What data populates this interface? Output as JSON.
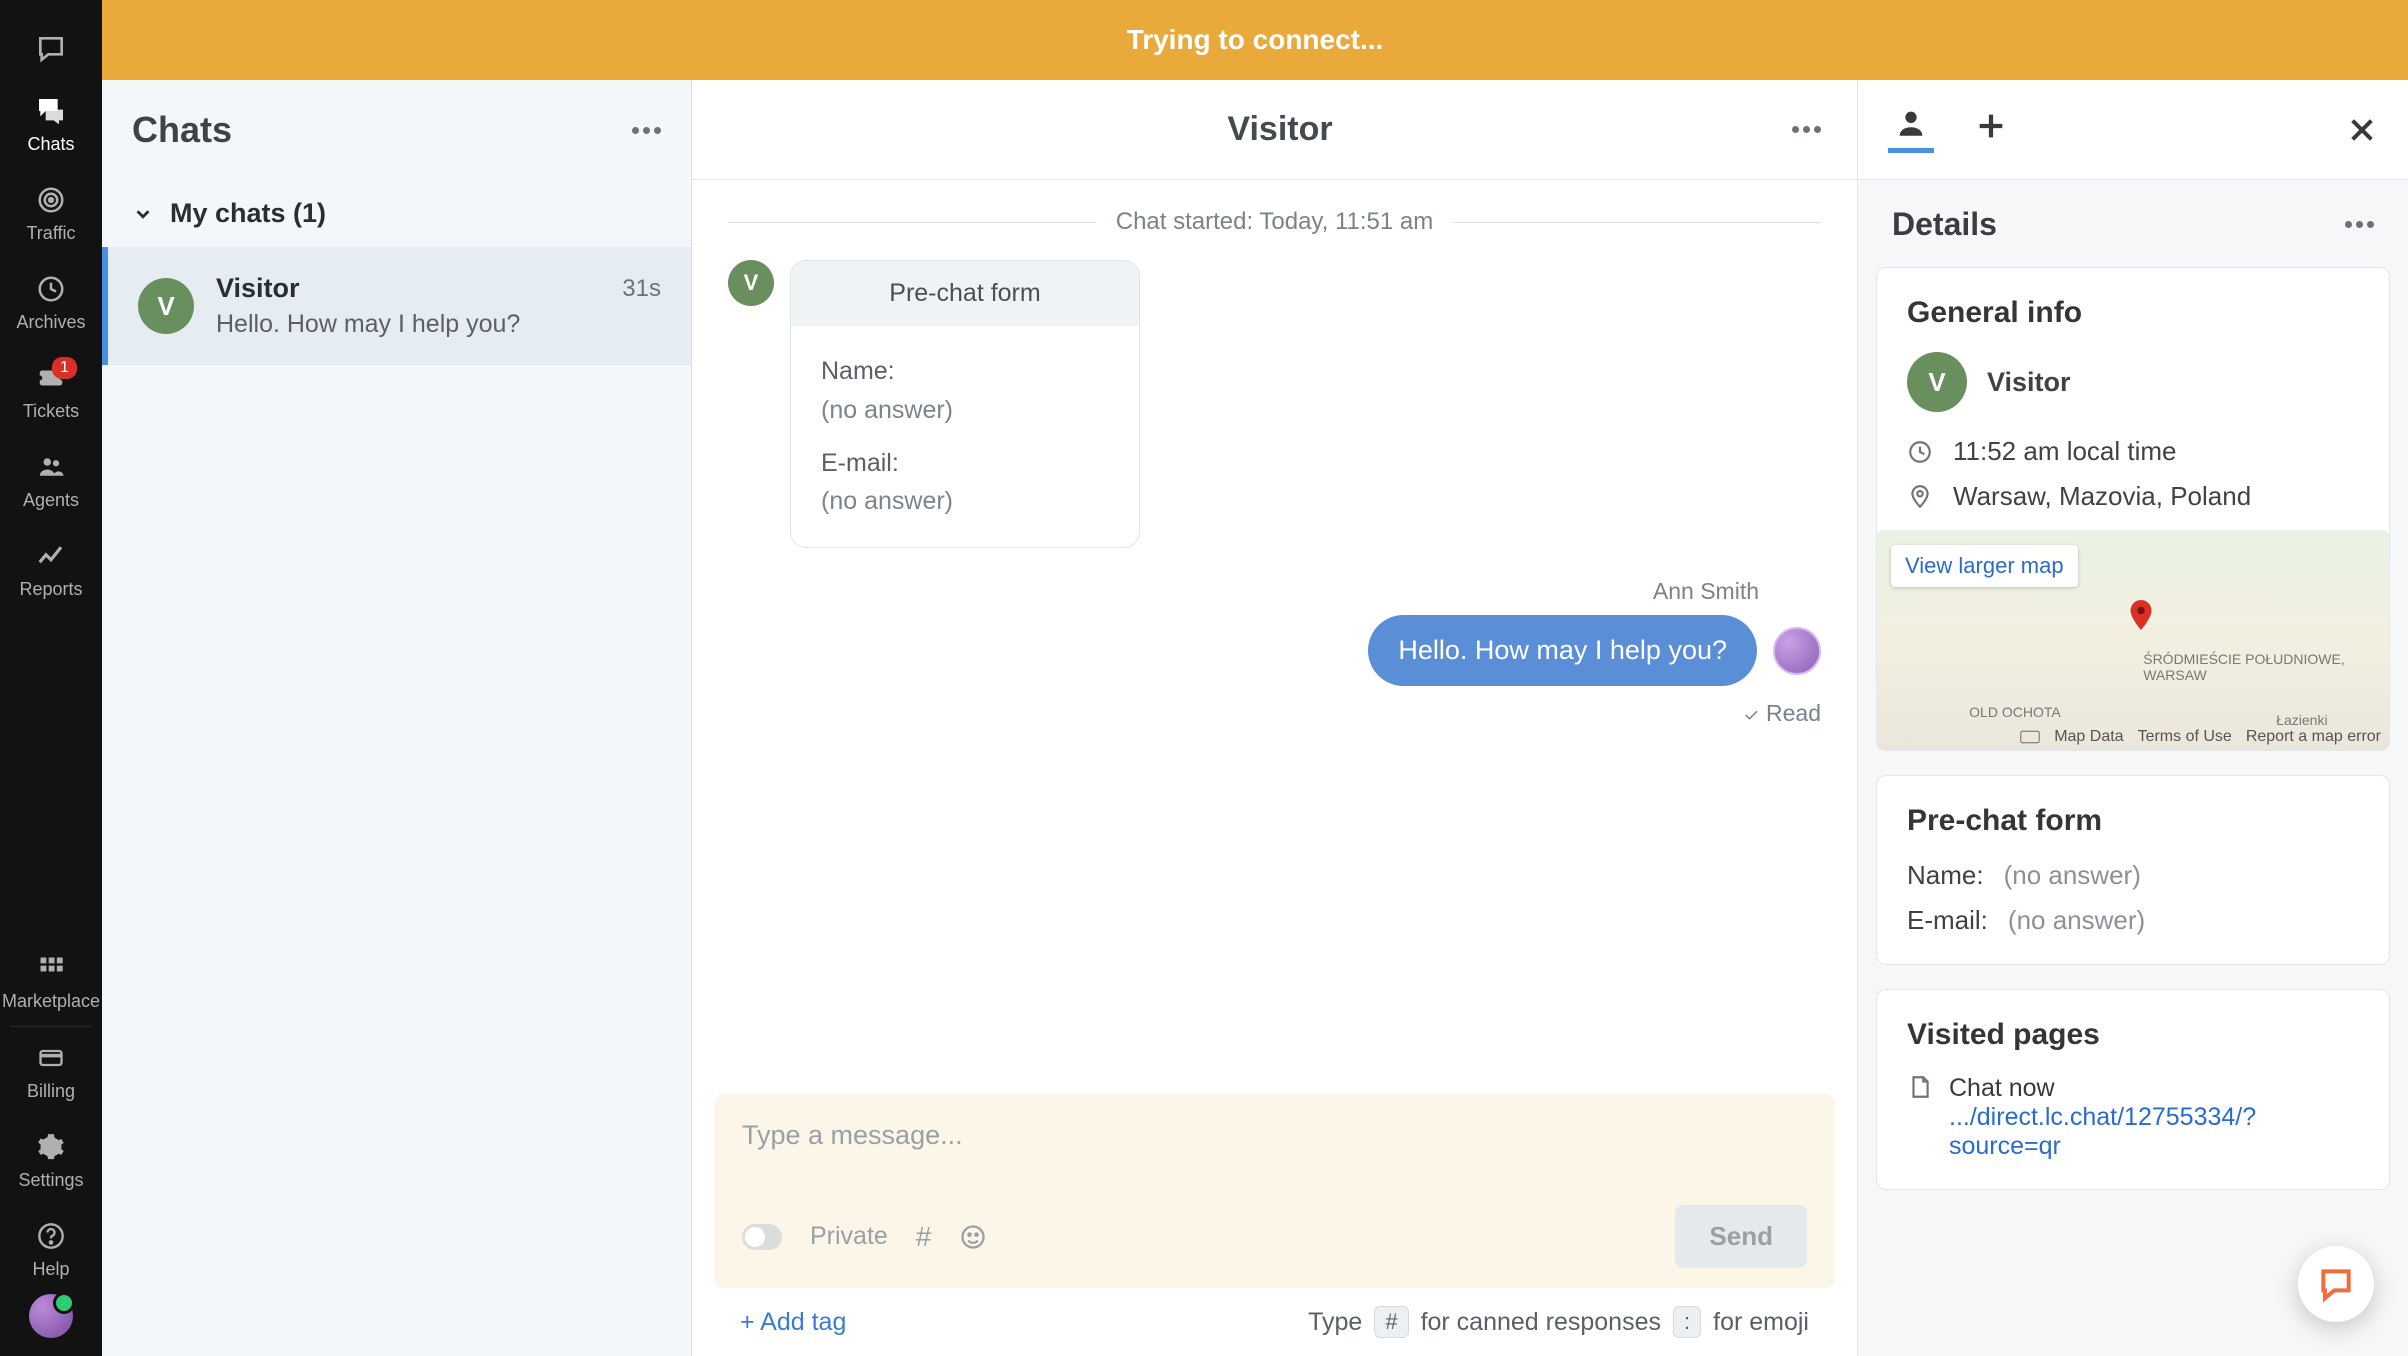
{
  "banner": {
    "text": "Trying to connect..."
  },
  "leftnav": {
    "items": [
      {
        "label": "",
        "icon": "speech-bubble-outline"
      },
      {
        "label": "Chats",
        "icon": "chats",
        "active": true
      },
      {
        "label": "Traffic",
        "icon": "target"
      },
      {
        "label": "Archives",
        "icon": "clock"
      },
      {
        "label": "Tickets",
        "icon": "ticket",
        "badge": "1"
      },
      {
        "label": "Agents",
        "icon": "people"
      },
      {
        "label": "Reports",
        "icon": "trend"
      }
    ],
    "bottom": [
      {
        "label": "Marketplace",
        "icon": "grid"
      },
      {
        "label": "Billing",
        "icon": "card"
      },
      {
        "label": "Settings",
        "icon": "gear"
      },
      {
        "label": "Help",
        "icon": "question"
      }
    ]
  },
  "chatlist": {
    "title": "Chats",
    "section": "My chats (1)",
    "items": [
      {
        "avatar": "V",
        "name": "Visitor",
        "time": "31s",
        "preview": "Hello. How may I help you?"
      }
    ]
  },
  "conversation": {
    "title": "Visitor",
    "started": "Chat started: Today, 11:51 am",
    "prechat": {
      "heading": "Pre-chat form",
      "name_label": "Name:",
      "name_value": "(no answer)",
      "email_label": "E-mail:",
      "email_value": "(no answer)",
      "avatar": "V"
    },
    "agent": {
      "name": "Ann Smith",
      "message": "Hello. How may I help you?",
      "status": "Read"
    },
    "composer": {
      "placeholder": "Type a message...",
      "private_label": "Private",
      "send_label": "Send"
    },
    "footer": {
      "add_tag": "+ Add tag",
      "type_label": "Type",
      "hash_key": "#",
      "canned": "for canned responses",
      "colon_key": ":",
      "emoji": "for emoji"
    }
  },
  "details": {
    "title": "Details",
    "general": {
      "heading": "General info",
      "avatar": "V",
      "name": "Visitor",
      "local_time": "11:52 am local time",
      "location": "Warsaw, Mazovia, Poland",
      "map": {
        "view_larger": "View larger map",
        "label1": "ŚRÓDMIEŚCIE POŁUDNIOWE, WARSAW",
        "label2": "OLD OCHOTA",
        "label3": "Łazienki",
        "attrib_mapdata": "Map Data",
        "attrib_terms": "Terms of Use",
        "attrib_report": "Report a map error"
      }
    },
    "prechat": {
      "heading": "Pre-chat form",
      "name_label": "Name:",
      "name_value": "(no answer)",
      "email_label": "E-mail:",
      "email_value": "(no answer)"
    },
    "visited": {
      "heading": "Visited pages",
      "page_title": "Chat now",
      "page_url": ".../direct.lc.chat/12755334/?source=qr"
    }
  }
}
